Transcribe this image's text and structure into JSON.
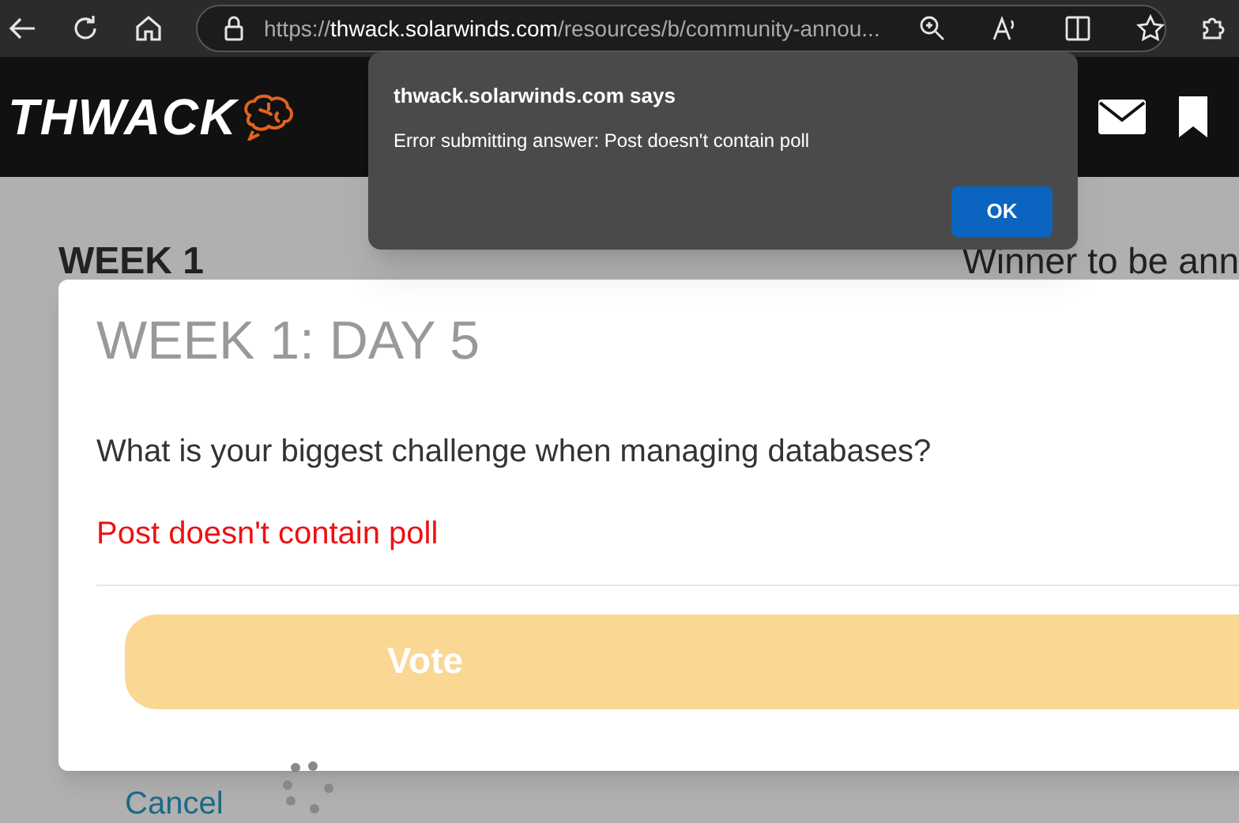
{
  "browser": {
    "url_host": "thwack.solarwinds.com",
    "url_prefix": "https://",
    "url_path": "/resources/b/community-annou..."
  },
  "site_header": {
    "logo": "THWACK"
  },
  "page": {
    "heading": "WEEK 1",
    "side_text": "Winner to be ann",
    "cancel": "Cancel"
  },
  "poll_card": {
    "title": "WEEK 1: DAY 5",
    "question": "What is your biggest challenge when managing databases?",
    "error": "Post doesn't contain poll",
    "vote_button": {
      "label": "Vote",
      "disabled": true
    }
  },
  "alert": {
    "title": "thwack.solarwinds.com says",
    "message": "Error submitting answer: Post doesn't contain poll",
    "ok": "OK"
  }
}
